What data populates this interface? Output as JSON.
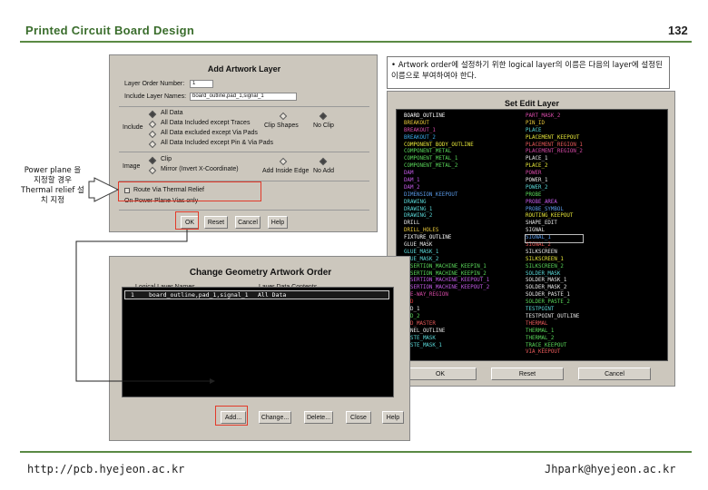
{
  "header": {
    "title": "Printed Circuit Board Design",
    "page_number": "132"
  },
  "footer": {
    "left": "http://pcb.hyejeon.ac.kr",
    "right": "Jhpark@hyejeon.ac.kr"
  },
  "note": {
    "text": "• Artwork order에 설정하기 위한 logical layer의 이름은 다음의 layer에 설정된 이름으로 부여하여야 한다."
  },
  "callout": {
    "text": "Power plane 을 지정할 경우 Thermal relief 설치 지정"
  },
  "add_artwork": {
    "title": "Add Artwork Layer",
    "layer_order_label": "Layer Order Number:",
    "layer_order_value": "1",
    "include_names_label": "Include Layer Names:",
    "include_names_value": "board_outline,pad_1,signal_1",
    "include_label": "Include",
    "include_options": [
      "All Data",
      "All Data Included except Traces",
      "All Data excluded except Via Pads",
      "All Data Included except Pin & Via Pads"
    ],
    "clip_label": "Clip Shapes",
    "no_clip_label": "No Clip",
    "image_label": "Image",
    "image_options": [
      "Clip",
      "Mirror (Invert X-Coordinate)"
    ],
    "add_fill_label": "Add Inside Edge",
    "no_add_label": "No Add",
    "thermal_label": "Route Via Thermal Relief",
    "power_plane_label": "On Power Plane Vias only",
    "buttons": {
      "ok": "OK",
      "reset": "Reset",
      "cancel": "Cancel",
      "help": "Help"
    }
  },
  "set_edit": {
    "title": "Set Edit Layer",
    "left_column": [
      "BOARD_OUTLINE",
      "BREAKOUT",
      "BREAKOUT_1",
      "BREAKOUT_2",
      "COMPONENT_BODY_OUTLINE",
      "COMPONENT_METAL",
      "COMPONENT_METAL_1",
      "COMPONENT_METAL_2",
      "DAM",
      "DAM_1",
      "DAM_2",
      "DIMENSION_KEEPOUT",
      "DRAWING",
      "DRAWING_1",
      "DRAWING_2",
      "DRILL",
      "DRILL_HOLES",
      "FIXTURE_OUTLINE",
      "GLUE_MASK",
      "GLUE_MASK_1",
      "GLUE_MASK_2",
      "INSERTION_MACHINE_KEEPIN_1",
      "INSERTION_MACHINE_KEEPIN_2",
      "INSERTION_MACHINE_KEEPOUT_1",
      "INSERTION_MACHINE_KEEPOUT_2",
      "ONE-WAY_REGION",
      "PAD",
      "PAD_1",
      "PAD_2",
      "PAD_MASTER",
      "PANEL_OUTLINE",
      "PASTE_MASK",
      "PASTE_MASK_1"
    ],
    "left_colors": [
      "#ffffff",
      "#e8c83a",
      "#d84aa8",
      "#3aa8e8",
      "#e8e83a",
      "#5ad85a",
      "#5ad85a",
      "#5ad85a",
      "#c45ae8",
      "#c45ae8",
      "#c45ae8",
      "#5a9ae8",
      "#5ad8d8",
      "#5ad8d8",
      "#5ad8d8",
      "#e8e8e8",
      "#e8c83a",
      "#ffffff",
      "#e8e8e8",
      "#5ad8d8",
      "#5ad8d8",
      "#5ad85a",
      "#5ad85a",
      "#c45ae8",
      "#c45ae8",
      "#d84aa8",
      "#e83a3a",
      "#e8e8e8",
      "#5ad85a",
      "#e85a5a",
      "#e8e8e8",
      "#5ad8d8",
      "#5ad8d8"
    ],
    "right_column": [
      "PART_MASK_2",
      "PIN_ID",
      "PLACE",
      "PLACEMENT_KEEPOUT",
      "PLACEMENT_REGION_1",
      "PLACEMENT_REGION_2",
      "PLACE_1",
      "PLACE_2",
      "POWER",
      "POWER_1",
      "POWER_2",
      "PROBE",
      "PROBE_AREA",
      "PROBE_SYMBOL",
      "ROUTING_KEEPOUT",
      "SHAPE_EDIT",
      "SIGNAL",
      "SIGNAL_1",
      "SIGNAL_2",
      "SILKSCREEN",
      "SILKSCREEN_1",
      "SILKSCREEN_2",
      "SOLDER_MASK",
      "SOLDER_MASK_1",
      "SOLDER_MASK_2",
      "SOLDER_PASTE_1",
      "SOLDER_PASTE_2",
      "TESTPOINT",
      "TESTPOINT_OUTLINE",
      "THERMAL",
      "THERMAL_1",
      "THERMAL_2",
      "TRACE_KEEPOUT",
      "VIA_KEEPOUT"
    ],
    "right_colors": [
      "#d84aa8",
      "#e8c83a",
      "#5ad8d8",
      "#e8e83a",
      "#e85a5a",
      "#d84aa8",
      "#e8e8e8",
      "#e8e83a",
      "#d84aa8",
      "#e8e8e8",
      "#5ad8d8",
      "#5ad85a",
      "#c45ae8",
      "#5a9ae8",
      "#e8e83a",
      "#e8e8e8",
      "#e8e8e8",
      "#5a9ae8",
      "#e85a5a",
      "#e8e8e8",
      "#e8e83a",
      "#5ad85a",
      "#5ad8d8",
      "#e8e8e8",
      "#e8e8e8",
      "#e8e8e8",
      "#5ad85a",
      "#5ad8d8",
      "#e8e8e8",
      "#e85a5a",
      "#5ad85a",
      "#5ad85a",
      "#5ad85a",
      "#e85a5a"
    ],
    "selected_index": 17,
    "buttons": {
      "ok": "OK",
      "reset": "Reset",
      "cancel": "Cancel"
    }
  },
  "change_geometry": {
    "title": "Change Geometry Artwork Order",
    "col_logical": "Logical Layer Names",
    "col_data": "Layer Data Contents",
    "row_index": "1",
    "row_names": "board_outline,pad_1,signal_1",
    "row_data": "All Data",
    "buttons": {
      "add": "Add...",
      "change": "Change...",
      "delete": "Delete...",
      "close": "Close",
      "help": "Help"
    }
  },
  "colors": {
    "accent_green": "#3a6d2c",
    "highlight_red": "#e23a2a",
    "dialog_gray": "#ccc7bd"
  }
}
